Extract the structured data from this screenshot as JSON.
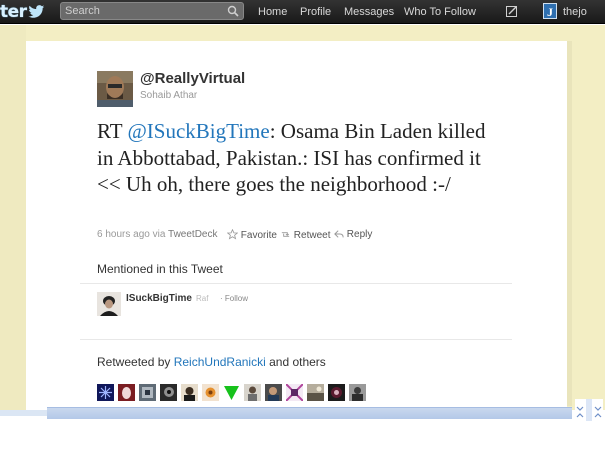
{
  "topbar": {
    "logo_text": "ter",
    "search_placeholder": "Search",
    "nav": [
      {
        "label": "Home"
      },
      {
        "label": "Profile"
      },
      {
        "label": "Messages"
      },
      {
        "label": "Who To Follow"
      }
    ],
    "account_initial": "J",
    "account_name": "thejo"
  },
  "tweet": {
    "handle": "@ReallyVirtual",
    "real_name": "Sohaib Athar",
    "text_prefix": "RT ",
    "mention": "@ISuckBigTime",
    "text_rest": ": Osama Bin Laden killed in Abbottabad, Pakistan.: ISI has confirmed it << Uh oh, there goes the neighborhood :-/",
    "time": "6 hours ago",
    "via": "via",
    "client": "TweetDeck",
    "actions": {
      "favorite": "Favorite",
      "retweet": "Retweet",
      "reply": "Reply"
    }
  },
  "mentioned": {
    "title": "Mentioned in this Tweet",
    "handle": "ISuckBigTime",
    "name": "Raf",
    "separator": "·",
    "follow": "Follow"
  },
  "retweeted": {
    "prefix": "Retweeted by ",
    "user": "ReichUndRanicki",
    "suffix": " and others"
  },
  "colors": {
    "link": "#2276bb",
    "topbar": "#222222",
    "background": "#f3eec4",
    "logo": "#d9f1ff"
  }
}
